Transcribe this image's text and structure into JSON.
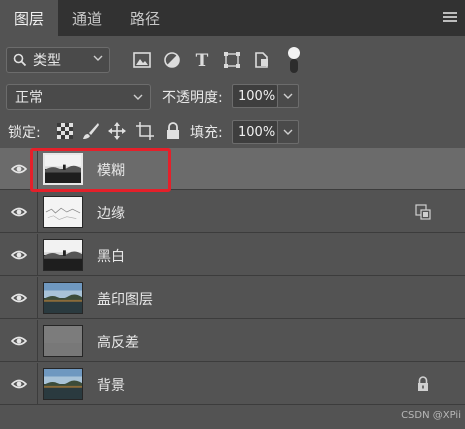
{
  "tabs": [
    {
      "label": "图层",
      "active": true
    },
    {
      "label": "通道",
      "active": false
    },
    {
      "label": "路径",
      "active": false
    }
  ],
  "filter": {
    "kind_label": "类型",
    "icons": [
      "image-filter-icon",
      "adjustment-filter-icon",
      "type-filter-icon",
      "shape-filter-icon",
      "smart-object-filter-icon"
    ]
  },
  "blend": {
    "mode": "正常",
    "opacity_label": "不透明度:",
    "opacity": "100%"
  },
  "lock": {
    "label": "锁定:",
    "fill_label": "填充:",
    "fill": "100%"
  },
  "layers": [
    {
      "name": "模糊",
      "visible": true,
      "selected": true,
      "thumb": "bw"
    },
    {
      "name": "边缘",
      "visible": true,
      "selected": false,
      "thumb": "edge",
      "badge": "smart-object-icon"
    },
    {
      "name": "黑白",
      "visible": true,
      "selected": false,
      "thumb": "bw"
    },
    {
      "name": "盖印图层",
      "visible": true,
      "selected": false,
      "thumb": "color"
    },
    {
      "name": "高反差",
      "visible": true,
      "selected": false,
      "thumb": "gray"
    },
    {
      "name": "背景",
      "visible": true,
      "selected": false,
      "thumb": "color",
      "badge": "lock-icon"
    }
  ],
  "watermark": "CSDN @XPii",
  "colors": {
    "panel_bg": "#535353",
    "tabbar_bg": "#323232",
    "selected_row": "#6b6b6b",
    "highlight": "#e5202a"
  }
}
